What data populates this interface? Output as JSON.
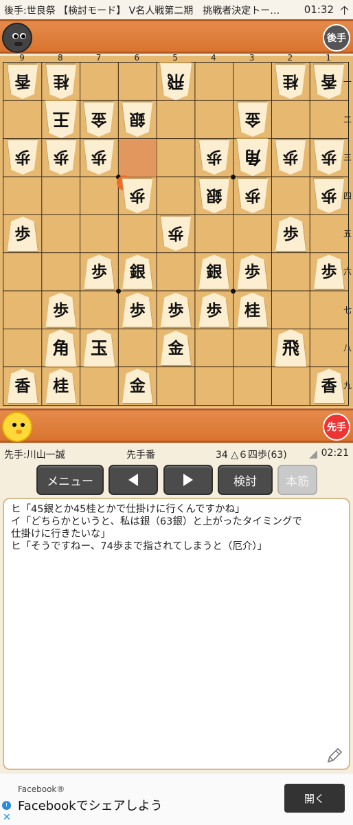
{
  "status_bar": {
    "title": "後手:世良祭 【検討モード】 V名人戦第二期　挑戦者決定トー…",
    "clock": "01:32",
    "arrow": "🡡"
  },
  "gote": {
    "badge": "後手"
  },
  "sente": {
    "badge": "先手"
  },
  "board": {
    "files": [
      "9",
      "8",
      "7",
      "6",
      "5",
      "4",
      "3",
      "2",
      "1"
    ],
    "ranks": [
      "一",
      "二",
      "三",
      "四",
      "五",
      "六",
      "七",
      "八",
      "九"
    ],
    "pieces": [
      {
        "f": 9,
        "r": 1,
        "p": "香",
        "side": "gote"
      },
      {
        "f": 8,
        "r": 1,
        "p": "桂",
        "side": "gote"
      },
      {
        "f": 5,
        "r": 1,
        "p": "飛",
        "side": "gote"
      },
      {
        "f": 2,
        "r": 1,
        "p": "桂",
        "side": "gote"
      },
      {
        "f": 1,
        "r": 1,
        "p": "香",
        "side": "gote"
      },
      {
        "f": 8,
        "r": 2,
        "p": "王",
        "side": "gote"
      },
      {
        "f": 7,
        "r": 2,
        "p": "金",
        "side": "gote"
      },
      {
        "f": 6,
        "r": 2,
        "p": "銀",
        "side": "gote"
      },
      {
        "f": 3,
        "r": 2,
        "p": "金",
        "side": "gote"
      },
      {
        "f": 9,
        "r": 3,
        "p": "歩",
        "side": "gote"
      },
      {
        "f": 8,
        "r": 3,
        "p": "歩",
        "side": "gote"
      },
      {
        "f": 7,
        "r": 3,
        "p": "歩",
        "side": "gote"
      },
      {
        "f": 4,
        "r": 3,
        "p": "歩",
        "side": "gote"
      },
      {
        "f": 3,
        "r": 3,
        "p": "角",
        "side": "gote"
      },
      {
        "f": 2,
        "r": 3,
        "p": "歩",
        "side": "gote"
      },
      {
        "f": 1,
        "r": 3,
        "p": "歩",
        "side": "gote"
      },
      {
        "f": 6,
        "r": 4,
        "p": "歩",
        "side": "gote"
      },
      {
        "f": 4,
        "r": 4,
        "p": "銀",
        "side": "gote"
      },
      {
        "f": 3,
        "r": 4,
        "p": "歩",
        "side": "gote"
      },
      {
        "f": 1,
        "r": 4,
        "p": "歩",
        "side": "gote"
      },
      {
        "f": 5,
        "r": 5,
        "p": "歩",
        "side": "gote"
      },
      {
        "f": 9,
        "r": 5,
        "p": "歩",
        "side": "sente"
      },
      {
        "f": 2,
        "r": 5,
        "p": "歩",
        "side": "sente"
      },
      {
        "f": 7,
        "r": 6,
        "p": "歩",
        "side": "sente"
      },
      {
        "f": 6,
        "r": 6,
        "p": "銀",
        "side": "sente"
      },
      {
        "f": 4,
        "r": 6,
        "p": "銀",
        "side": "sente"
      },
      {
        "f": 3,
        "r": 6,
        "p": "歩",
        "side": "sente"
      },
      {
        "f": 1,
        "r": 6,
        "p": "歩",
        "side": "sente"
      },
      {
        "f": 8,
        "r": 7,
        "p": "歩",
        "side": "sente"
      },
      {
        "f": 6,
        "r": 7,
        "p": "歩",
        "side": "sente"
      },
      {
        "f": 5,
        "r": 7,
        "p": "歩",
        "side": "sente"
      },
      {
        "f": 4,
        "r": 7,
        "p": "歩",
        "side": "sente"
      },
      {
        "f": 3,
        "r": 7,
        "p": "桂",
        "side": "sente"
      },
      {
        "f": 8,
        "r": 8,
        "p": "角",
        "side": "sente"
      },
      {
        "f": 7,
        "r": 8,
        "p": "玉",
        "side": "sente"
      },
      {
        "f": 5,
        "r": 8,
        "p": "金",
        "side": "sente"
      },
      {
        "f": 2,
        "r": 8,
        "p": "飛",
        "side": "sente"
      },
      {
        "f": 9,
        "r": 9,
        "p": "香",
        "side": "sente"
      },
      {
        "f": 8,
        "r": 9,
        "p": "桂",
        "side": "sente"
      },
      {
        "f": 6,
        "r": 9,
        "p": "金",
        "side": "sente"
      },
      {
        "f": 1,
        "r": 9,
        "p": "香",
        "side": "sente"
      }
    ],
    "last_move_from": {
      "f": 6,
      "r": 3
    },
    "last_move_to": {
      "f": 6,
      "r": 4
    }
  },
  "info": {
    "sente_name": "先手:川山一誠",
    "turn": "先手番",
    "move": "34 △６四歩(63)",
    "time": "02:21"
  },
  "buttons": {
    "menu": "メニュー",
    "review": "検討",
    "mainline": "本筋"
  },
  "comments": [
    "ヒ「45銀とか45桂とかで仕掛けに行くんですかね」",
    "イ「どちらかというと、私は銀（63銀）と上がったタイミングで\n仕掛けに行きたいな」",
    "ヒ「そうですねー、74歩まで指されてしまうと（厄介）」"
  ],
  "ad": {
    "brand": "Facebook®",
    "title": "Facebookでシェアしよう",
    "button": "開く",
    "info": "i",
    "close": "✕"
  }
}
